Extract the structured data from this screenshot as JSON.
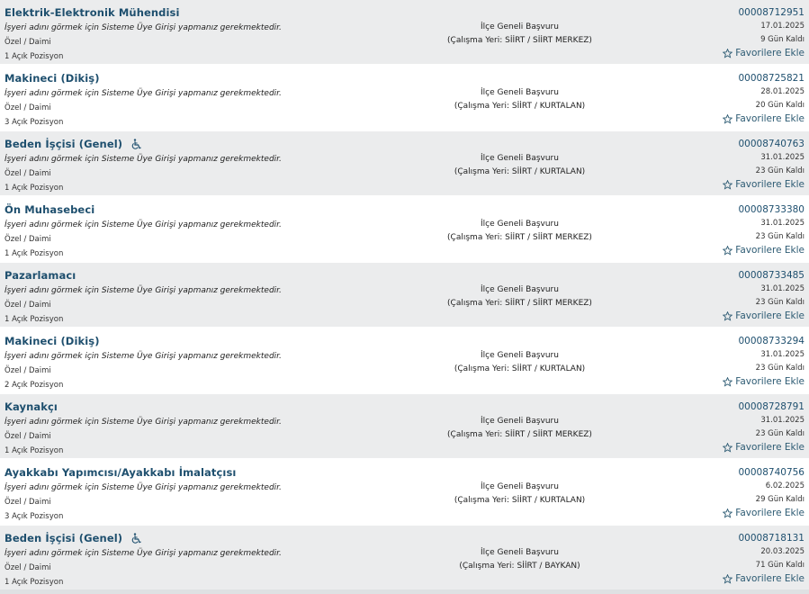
{
  "jobs": [
    {
      "title": "Elektrik-Elektronik Mühendisi",
      "accessible": false,
      "employer_note": "İşyeri adını görmek için Sisteme Üye Girişi yapmanız gerekmektedir.",
      "type": "Özel / Daimi",
      "positions": "1 Açık Pozisyon",
      "apply": "İlçe Geneli Başvuru",
      "location": "(Çalışma Yeri: SİİRT / SİİRT MERKEZ)",
      "ilan_no": "00008712951",
      "date": "17.01.2025",
      "days_left": "9 Gün Kaldı",
      "fav_label": "Favorilere Ekle"
    },
    {
      "title": "Makineci (Dikiş)",
      "accessible": false,
      "employer_note": "İşyeri adını görmek için Sisteme Üye Girişi yapmanız gerekmektedir.",
      "type": "Özel / Daimi",
      "positions": "3 Açık Pozisyon",
      "apply": "İlçe Geneli Başvuru",
      "location": "(Çalışma Yeri: SİİRT / KURTALAN)",
      "ilan_no": "00008725821",
      "date": "28.01.2025",
      "days_left": "20 Gün Kaldı",
      "fav_label": "Favorilere Ekle"
    },
    {
      "title": "Beden İşçisi (Genel)",
      "accessible": true,
      "employer_note": "İşyeri adını görmek için Sisteme Üye Girişi yapmanız gerekmektedir.",
      "type": "Özel / Daimi",
      "positions": "1 Açık Pozisyon",
      "apply": "İlçe Geneli Başvuru",
      "location": "(Çalışma Yeri: SİİRT / KURTALAN)",
      "ilan_no": "00008740763",
      "date": "31.01.2025",
      "days_left": "23 Gün Kaldı",
      "fav_label": "Favorilere Ekle"
    },
    {
      "title": "Ön Muhasebeci",
      "accessible": false,
      "employer_note": "İşyeri adını görmek için Sisteme Üye Girişi yapmanız gerekmektedir.",
      "type": "Özel / Daimi",
      "positions": "1 Açık Pozisyon",
      "apply": "İlçe Geneli Başvuru",
      "location": "(Çalışma Yeri: SİİRT / SİİRT MERKEZ)",
      "ilan_no": "00008733380",
      "date": "31.01.2025",
      "days_left": "23 Gün Kaldı",
      "fav_label": "Favorilere Ekle"
    },
    {
      "title": "Pazarlamacı",
      "accessible": false,
      "employer_note": "İşyeri adını görmek için Sisteme Üye Girişi yapmanız gerekmektedir.",
      "type": "Özel / Daimi",
      "positions": "1 Açık Pozisyon",
      "apply": "İlçe Geneli Başvuru",
      "location": "(Çalışma Yeri: SİİRT / SİİRT MERKEZ)",
      "ilan_no": "00008733485",
      "date": "31.01.2025",
      "days_left": "23 Gün Kaldı",
      "fav_label": "Favorilere Ekle"
    },
    {
      "title": "Makineci (Dikiş)",
      "accessible": false,
      "employer_note": "İşyeri adını görmek için Sisteme Üye Girişi yapmanız gerekmektedir.",
      "type": "Özel / Daimi",
      "positions": "2 Açık Pozisyon",
      "apply": "İlçe Geneli Başvuru",
      "location": "(Çalışma Yeri: SİİRT / KURTALAN)",
      "ilan_no": "00008733294",
      "date": "31.01.2025",
      "days_left": "23 Gün Kaldı",
      "fav_label": "Favorilere Ekle"
    },
    {
      "title": "Kaynakçı",
      "accessible": false,
      "employer_note": "İşyeri adını görmek için Sisteme Üye Girişi yapmanız gerekmektedir.",
      "type": "Özel / Daimi",
      "positions": "1 Açık Pozisyon",
      "apply": "İlçe Geneli Başvuru",
      "location": "(Çalışma Yeri: SİİRT / SİİRT MERKEZ)",
      "ilan_no": "00008728791",
      "date": "31.01.2025",
      "days_left": "23 Gün Kaldı",
      "fav_label": "Favorilere Ekle"
    },
    {
      "title": "Ayakkabı Yapımcısı/Ayakkabı İmalatçısı",
      "accessible": false,
      "employer_note": "İşyeri adını görmek için Sisteme Üye Girişi yapmanız gerekmektedir.",
      "type": "Özel / Daimi",
      "positions": "3 Açık Pozisyon",
      "apply": "İlçe Geneli Başvuru",
      "location": "(Çalışma Yeri: SİİRT / KURTALAN)",
      "ilan_no": "00008740756",
      "date": "6.02.2025",
      "days_left": "29 Gün Kaldı",
      "fav_label": "Favorilere Ekle"
    },
    {
      "title": "Beden İşçisi (Genel)",
      "accessible": true,
      "employer_note": "İşyeri adını görmek için Sisteme Üye Girişi yapmanız gerekmektedir.",
      "type": "Özel / Daimi",
      "positions": "1 Açık Pozisyon",
      "apply": "İlçe Geneli Başvuru",
      "location": "(Çalışma Yeri: SİİRT / BAYKAN)",
      "ilan_no": "00008718131",
      "date": "20.03.2025",
      "days_left": "71 Gün Kaldı",
      "fav_label": "Favorilere Ekle"
    }
  ],
  "icons": {
    "favorite": "star-outline-icon",
    "accessible": "wheelchair-icon"
  },
  "colors": {
    "row_alt": "#ebeced",
    "title": "#1e4f6e",
    "link": "#2d5b73"
  }
}
